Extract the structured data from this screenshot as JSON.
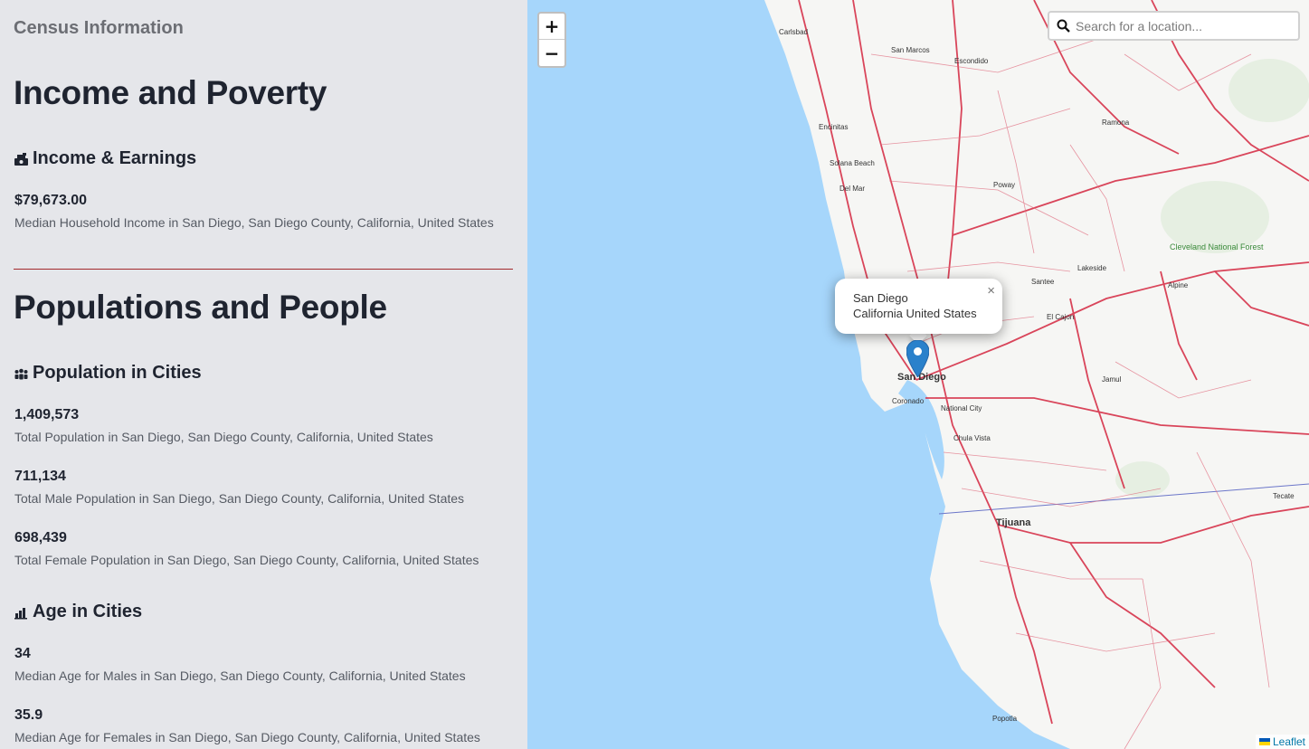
{
  "sidebar": {
    "title": "Census Information",
    "sections": {
      "income": {
        "title": "Income and Poverty",
        "group": "Income & Earnings",
        "stats": [
          {
            "value": "$79,673.00",
            "label": "Median Household Income in San Diego, San Diego County, California, United States"
          }
        ]
      },
      "population": {
        "title": "Populations and People",
        "group_population": "Population in Cities",
        "population_stats": [
          {
            "value": "1,409,573",
            "label": "Total Population in San Diego, San Diego County, California, United States"
          },
          {
            "value": "711,134",
            "label": "Total Male Population in San Diego, San Diego County, California, United States"
          },
          {
            "value": "698,439",
            "label": "Total Female Population in San Diego, San Diego County, California, United States"
          }
        ],
        "group_age": "Age in Cities",
        "age_stats": [
          {
            "value": "34",
            "label": "Median Age for Males in San Diego, San Diego County, California, United States"
          },
          {
            "value": "35.9",
            "label": "Median Age for Females in San Diego, San Diego County, California, United States"
          }
        ]
      }
    }
  },
  "map": {
    "zoom_in": "+",
    "zoom_out": "−",
    "search_placeholder": "Search for a location...",
    "popup": {
      "line1": "San Diego",
      "line2": "California United States",
      "close": "×"
    },
    "attribution": "Leaflet",
    "labels": {
      "san_diego": "San Diego",
      "tijuana": "Tijuana",
      "chula_vista": "Chula Vista",
      "national_city": "National City",
      "coronado": "Coronado",
      "carlsbad": "Carlsbad",
      "san_marcos": "San Marcos",
      "escondido": "Escondido",
      "encinitas": "Encinitas",
      "solana_beach": "Solana Beach",
      "del_mar": "Del Mar",
      "poway": "Poway",
      "santee": "Santee",
      "el_cajon": "El Cajon",
      "lakeside": "Lakeside",
      "ramona": "Ramona",
      "alpine": "Alpine",
      "jamul": "Jamul",
      "cleveland": "Cleveland National Forest",
      "tecate": "Tecate",
      "rosarito": "Popotla"
    },
    "colors": {
      "water": "#a6d6fb",
      "land": "#f7f7f5",
      "roads": "#d6324a",
      "park": "#3a9a3a"
    }
  }
}
